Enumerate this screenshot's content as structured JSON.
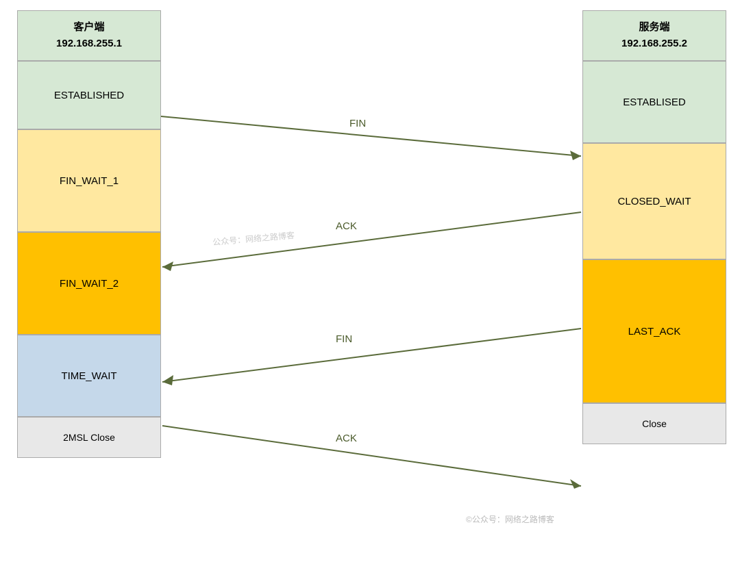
{
  "left": {
    "header_line1": "客户端",
    "header_line2": "192.168.255.1",
    "states": [
      {
        "id": "established",
        "label": "ESTABLISHED"
      },
      {
        "id": "fin-wait-1",
        "label": "FIN_WAIT_1"
      },
      {
        "id": "fin-wait-2",
        "label": "FIN_WAIT_2"
      },
      {
        "id": "time-wait",
        "label": "TIME_WAIT"
      },
      {
        "id": "2msl",
        "label": "2MSL Close"
      }
    ]
  },
  "right": {
    "header_line1": "服务端",
    "header_line2": "192.168.255.2",
    "states": [
      {
        "id": "established",
        "label": "ESTABLISED"
      },
      {
        "id": "closed-wait",
        "label": "CLOSED_WAIT"
      },
      {
        "id": "last-ack",
        "label": "LAST_ACK"
      },
      {
        "id": "close",
        "label": "Close"
      }
    ]
  },
  "arrows": [
    {
      "label": "FIN",
      "direction": "right"
    },
    {
      "label": "ACK",
      "direction": "left"
    },
    {
      "label": "FIN",
      "direction": "left"
    },
    {
      "label": "ACK",
      "direction": "right"
    }
  ],
  "watermarks": [
    {
      "text": "公众号：网络之路博客"
    },
    {
      "text": "©公众号：网络之路博客"
    }
  ]
}
